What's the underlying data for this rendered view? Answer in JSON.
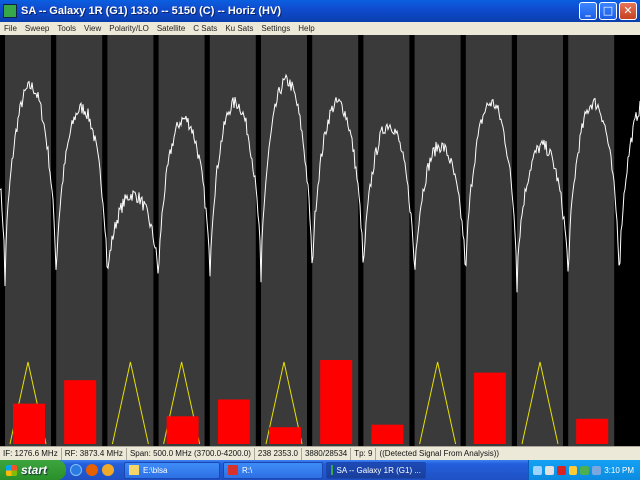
{
  "window": {
    "title": "SA -- Galaxy 1R (G1) 133.0 -- 5150 (C) -- Horiz (HV)",
    "minimize_glyph": "_",
    "maximize_glyph": "□",
    "close_glyph": "✕"
  },
  "menu": [
    "File",
    "Sweep",
    "Tools",
    "View",
    "Polarity/LO",
    "Satellite",
    "C Sats",
    "Ku Sats",
    "Settings",
    "Help"
  ],
  "status": {
    "if": "IF: 1276.6 MHz",
    "rf": "RF: 3873.4 MHz",
    "span": "Span: 500.0 MHz (3700.0-4200.0)",
    "cursor": "238 2353.0",
    "count": "3880/28534",
    "tp": "Tp: 9",
    "message": "((Detected Signal From Analysis))"
  },
  "taskbar": {
    "start_label": "start",
    "tasks": [
      {
        "label": "E:\\blsa",
        "icon_color": "#f5d56a"
      },
      {
        "label": "R:\\",
        "icon_color": "#d9312b"
      },
      {
        "label": "SA -- Galaxy 1R (G1) ...",
        "icon_color": "#36a84a"
      }
    ],
    "clock": "3:10 PM"
  },
  "icons": {
    "app": "spectrum-analyzer-icon",
    "quicklaunch": [
      "ie-icon",
      "firefox-icon",
      "media-player-icon"
    ],
    "tray": [
      "network-icon",
      "volume-icon",
      "antivirus-icon",
      "security-icon",
      "update-icon",
      "usb-icon"
    ]
  },
  "colors": {
    "trace": "#ffffff",
    "channel_band": "#3a3a3a",
    "signal_bar": "#ff0000",
    "marker_triangle": "#e8e000",
    "background": "#000000"
  },
  "chart_data": {
    "type": "line",
    "title": "",
    "xlabel": "",
    "ylabel": "",
    "x_range_mhz": [
      3700.0,
      4200.0
    ],
    "transponder_count": 12,
    "trace_levels": [
      0.92,
      0.84,
      0.52,
      0.8,
      0.86,
      0.94,
      0.86,
      0.78,
      0.7,
      0.86,
      0.7,
      0.86
    ],
    "bar_levels": [
      0.48,
      0.76,
      0.0,
      0.33,
      0.53,
      0.2,
      1.0,
      0.23,
      0.0,
      0.85,
      0.0,
      0.3
    ],
    "marker_triangles": [
      1,
      0,
      1,
      1,
      0,
      1,
      0,
      0,
      1,
      0,
      1,
      0
    ]
  }
}
